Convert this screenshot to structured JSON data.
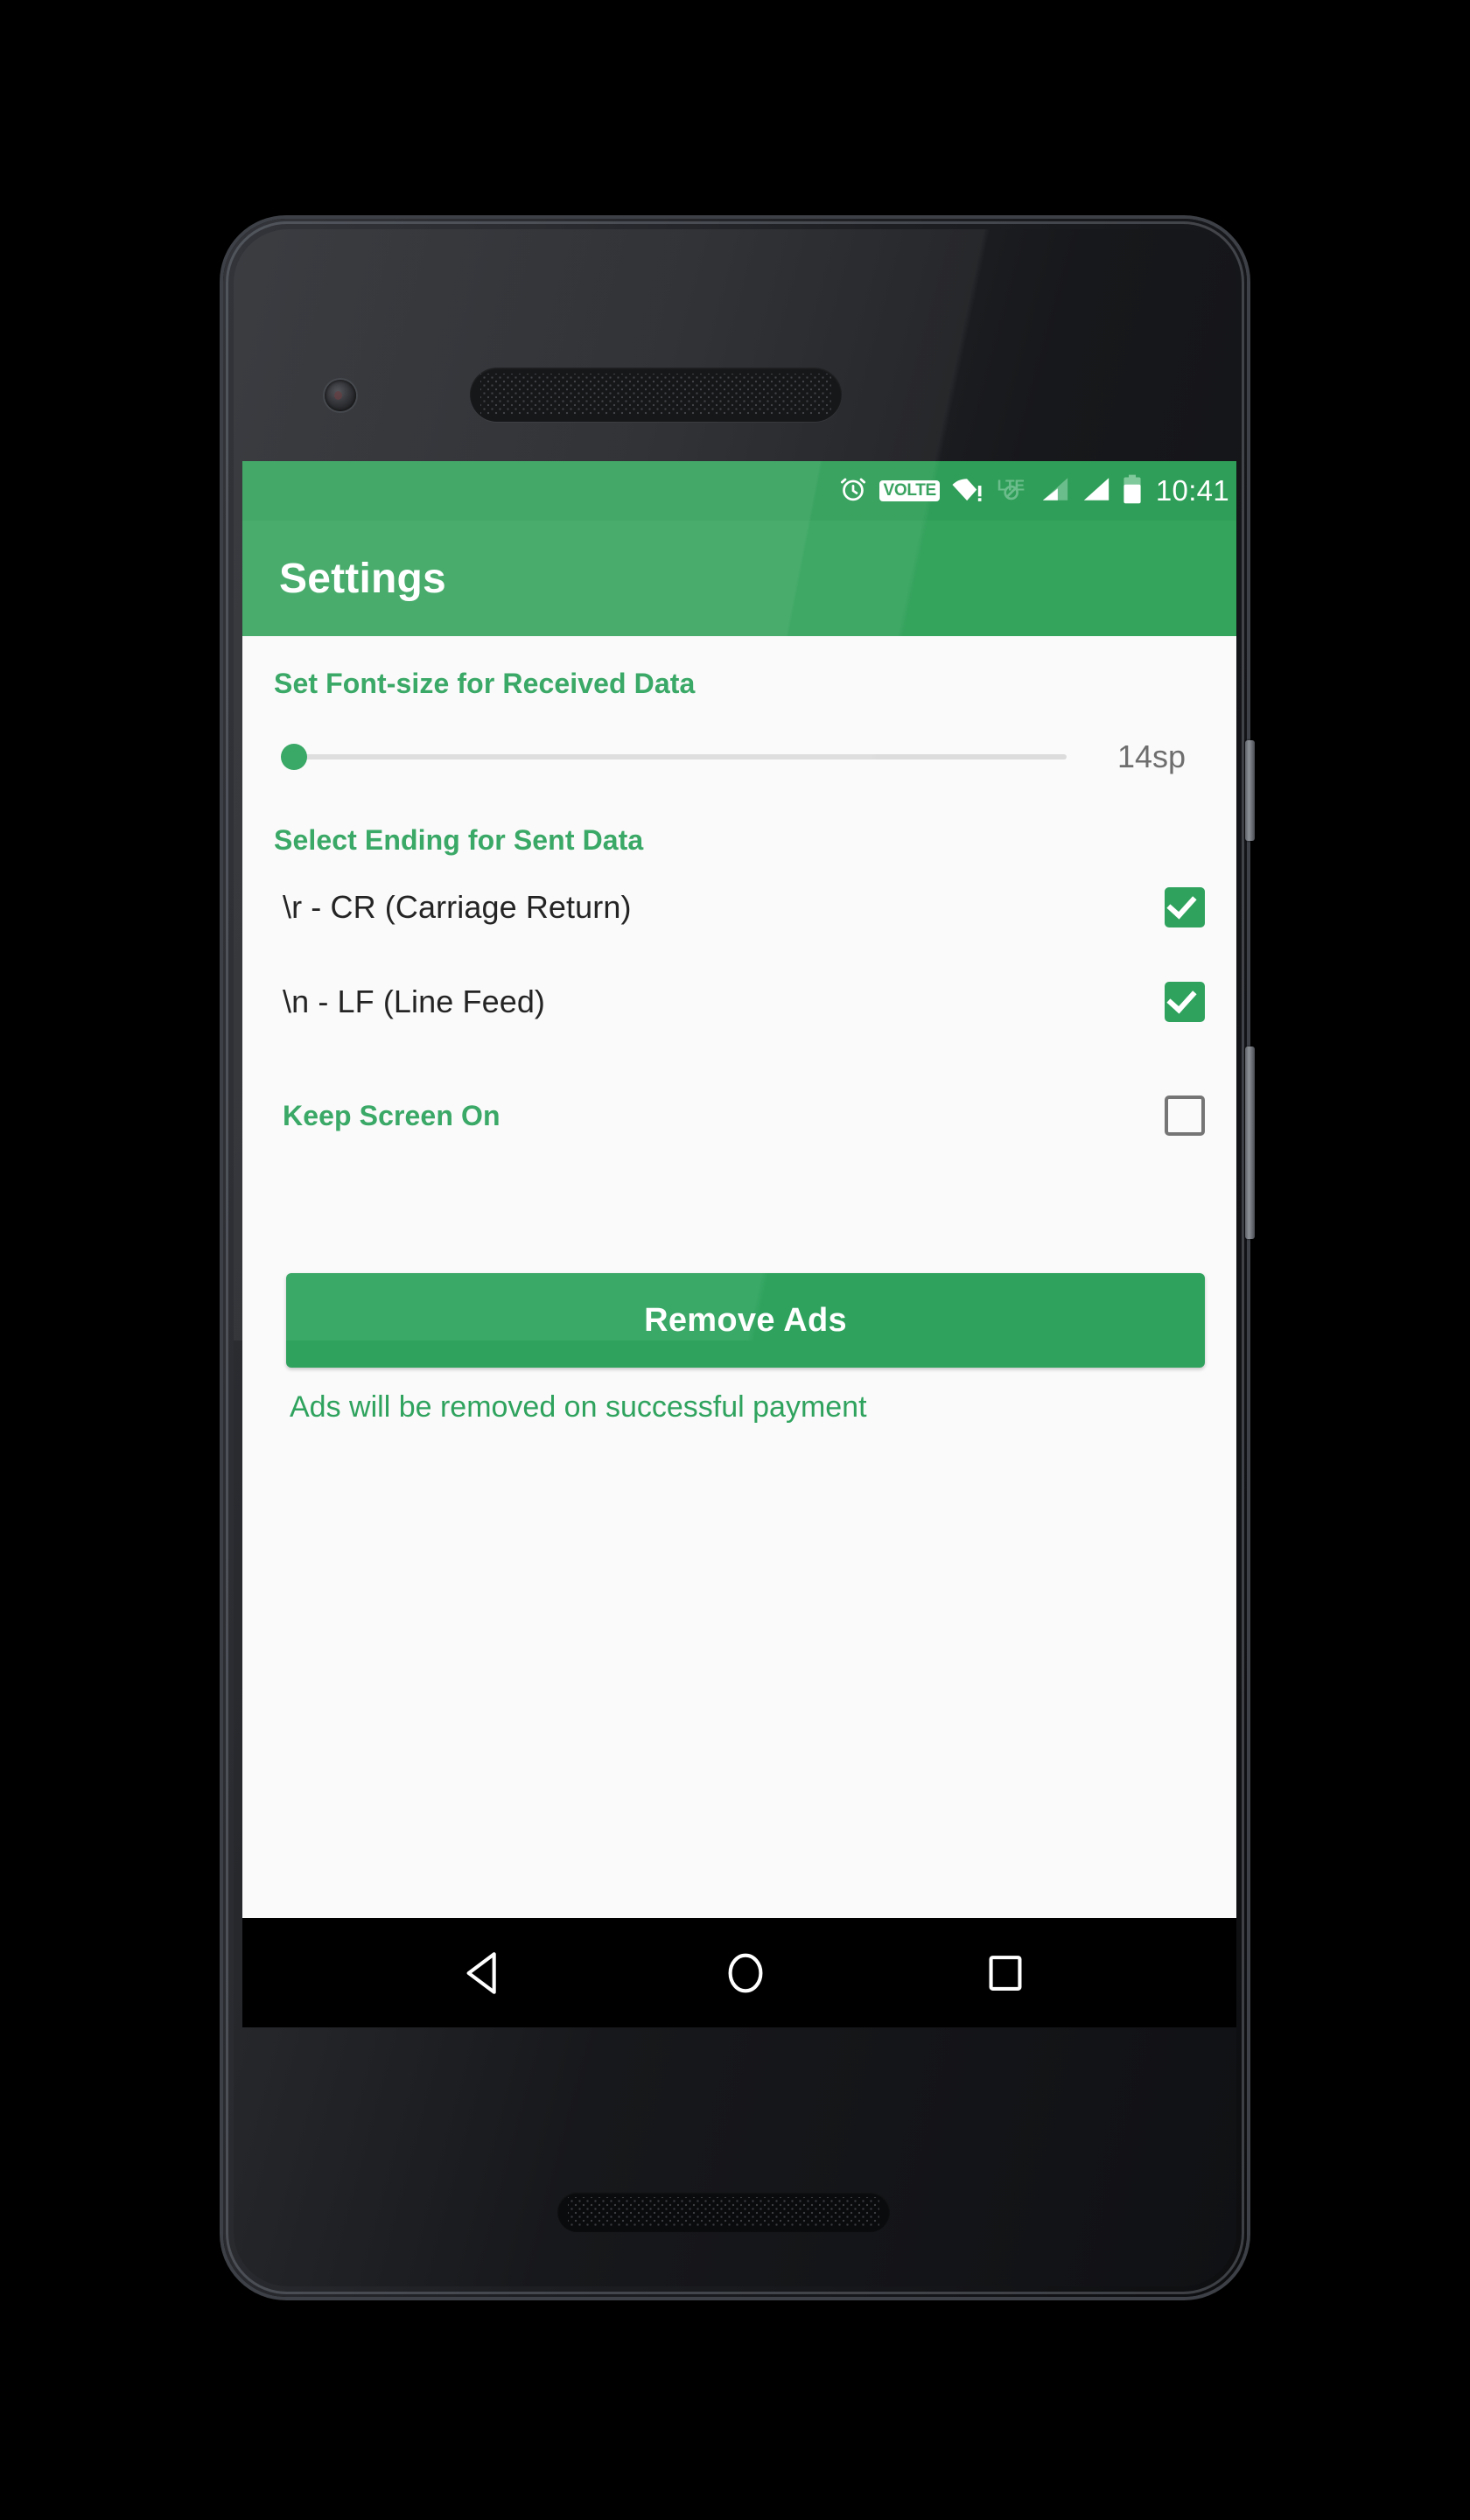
{
  "device": {
    "hardware": {
      "front_camera": "front-camera",
      "earpiece": "earpiece-speaker",
      "bottom_speaker": "bottom-speaker",
      "power_button": "power-button",
      "volume_button": "volume-rocker"
    }
  },
  "status_bar": {
    "background_color": "#2f9e58",
    "clock": "10:41",
    "icons": [
      {
        "name": "alarm-icon",
        "label": "alarm"
      },
      {
        "name": "volte-icon",
        "label": "VOLTE"
      },
      {
        "name": "wifi-warning-icon",
        "label": "wifi-no-internet"
      },
      {
        "name": "lte-disabled-icon",
        "label": "LTE"
      },
      {
        "name": "signal-sim1-icon",
        "label": "signal-1"
      },
      {
        "name": "signal-sim2-icon",
        "label": "signal-2"
      },
      {
        "name": "battery-icon",
        "label": "battery"
      }
    ]
  },
  "app_bar": {
    "title": "Settings",
    "background_color": "#34a35c"
  },
  "content": {
    "accent_color": "#2fa35e",
    "font_size_section": {
      "header": "Set Font-size for Received Data",
      "slider_value_label": "14sp",
      "slider_percent": 0
    },
    "ending_section": {
      "header": "Select Ending for Sent Data",
      "options": [
        {
          "label": "\\r - CR (Carriage Return)",
          "checked": true
        },
        {
          "label": "\\n - LF (Line Feed)",
          "checked": true
        }
      ]
    },
    "keep_screen_on": {
      "label": "Keep Screen On",
      "checked": false
    },
    "remove_ads": {
      "button_label": "Remove Ads",
      "note": "Ads will be removed on successful payment"
    }
  },
  "nav_bar": {
    "background_color": "#000000",
    "buttons": [
      {
        "name": "nav-back-button",
        "glyph": "back-triangle-icon"
      },
      {
        "name": "nav-home-button",
        "glyph": "home-circle-icon"
      },
      {
        "name": "nav-recents-button",
        "glyph": "recents-square-icon"
      }
    ]
  }
}
